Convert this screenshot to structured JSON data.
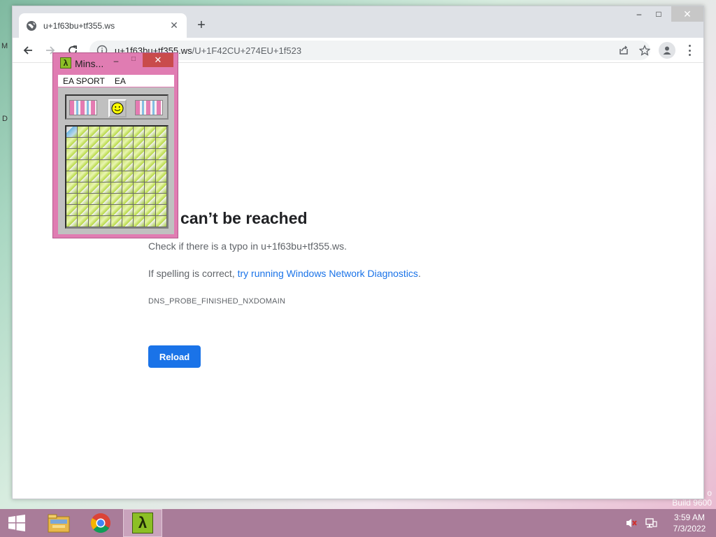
{
  "desktop": {
    "edge_left_top": "M",
    "edge_left_mid": "D",
    "watermark_line1": "o",
    "watermark_line2": "Build 9600"
  },
  "browser": {
    "tab": {
      "title": "u+1f63bu+tf355.ws",
      "favicon": "globe-icon"
    },
    "new_tab_label": "+",
    "window_controls": {
      "minimize": "–",
      "maximize": "□",
      "close": "✕"
    },
    "address": {
      "host": "u+1f63bu+tf355.ws",
      "path": "/U+1F42CU+274EU+1f523"
    }
  },
  "error_page": {
    "title": "This site can’t be reached",
    "title_visible": "site can’t be reached",
    "line1": "Check if there is a typo in u+1f63bu+tf355.ws.",
    "line2_prefix": "If spelling is correct, ",
    "line2_link": "try running Windows Network Diagnostics",
    "line2_suffix": ".",
    "error_code": "DNS_PROBE_FINISHED_NXDOMAIN",
    "reload_label": "Reload"
  },
  "minesweeper": {
    "title": "Mins...",
    "icon_glyph": "λ",
    "minimize": "–",
    "maximize": "□",
    "close": "✕",
    "menu": [
      "EA SPORT",
      "EA"
    ],
    "grid_rows": 9,
    "grid_cols": 9
  },
  "taskbar": {
    "items": [
      {
        "name": "file-explorer",
        "active": false
      },
      {
        "name": "chrome",
        "active": false
      },
      {
        "name": "minesweeper",
        "active": true,
        "glyph": "λ"
      }
    ],
    "clock_time": "3:59 AM",
    "clock_date": "7/3/2022"
  },
  "colors": {
    "accent_blue": "#1a73e8",
    "minesweeper_frame": "#e07cb2",
    "taskbar": "#a97c99"
  }
}
